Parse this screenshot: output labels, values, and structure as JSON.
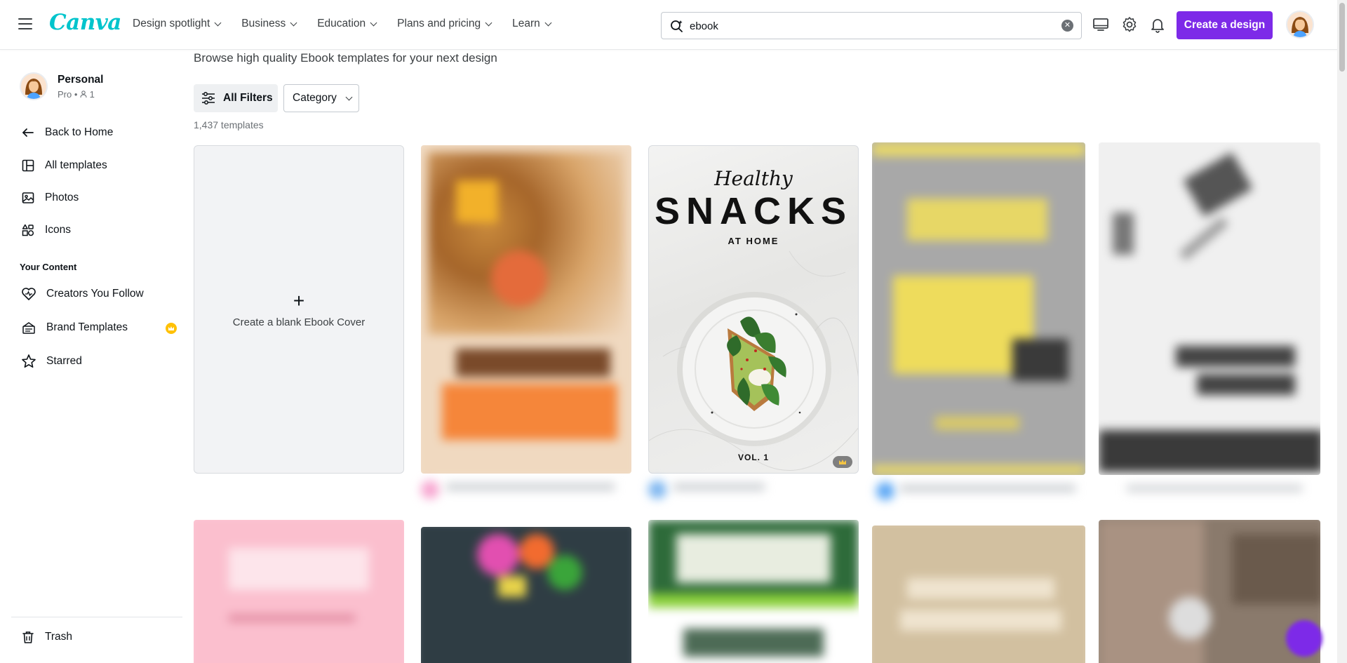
{
  "header": {
    "logo": "Canva",
    "nav": [
      {
        "label": "Design spotlight"
      },
      {
        "label": "Business"
      },
      {
        "label": "Education"
      },
      {
        "label": "Plans and pricing"
      },
      {
        "label": "Learn"
      }
    ],
    "search": {
      "value": "ebook",
      "placeholder": "Search"
    },
    "create_label": "Create a design"
  },
  "sidebar": {
    "profile": {
      "name": "Personal",
      "plan": "Pro",
      "members": "1"
    },
    "items": [
      {
        "label": "Back to Home"
      },
      {
        "label": "All templates"
      },
      {
        "label": "Photos"
      },
      {
        "label": "Icons"
      }
    ],
    "section_title": "Your Content",
    "content_items": [
      {
        "label": "Creators You Follow"
      },
      {
        "label": "Brand Templates"
      },
      {
        "label": "Starred"
      }
    ],
    "trash_label": "Trash"
  },
  "main": {
    "subtitle": "Browse high quality Ebook templates for your next design",
    "filters_label": "All Filters",
    "category_label": "Category",
    "count": "1,437 templates",
    "blank_card_label": "Create a blank Ebook Cover",
    "featured": {
      "title_script": "Healthy",
      "title_main": "SNACKS",
      "title_sub": "AT HOME",
      "volume": "VOL. 1"
    }
  },
  "colors": {
    "brand_purple": "#7d2ae8",
    "brand_teal": "#00c4cc",
    "badge_gold": "#ffc107"
  }
}
